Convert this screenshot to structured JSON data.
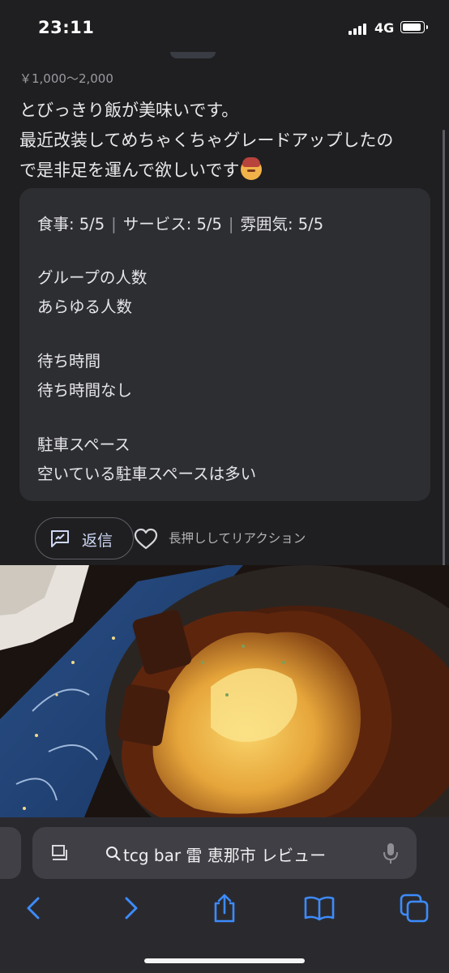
{
  "status_bar": {
    "time": "23:11",
    "network": "4G",
    "battery_level": 0.9
  },
  "review": {
    "price": "￥1,000～2,000",
    "text_lines": [
      "とびっきり飯が美味いです。",
      "最近改装してめちゃくちゃグレードアップしたの",
      "で是非足を運んで欲しいです"
    ],
    "emoji": "person-gesturing-ok-emoji",
    "ratings": {
      "food": "食事: 5/5",
      "service": "サービス: 5/5",
      "atmosphere": "雰囲気: 5/5",
      "separator": "|"
    },
    "details": [
      {
        "label": "グループの人数",
        "value": "あらゆる人数"
      },
      {
        "label": "待ち時間",
        "value": "待ち時間なし"
      },
      {
        "label": "駐車スペース",
        "value": "空いている駐車スペースは多い"
      }
    ],
    "reply_label": "返信",
    "reaction_hint": "長押ししてリアクション"
  },
  "browser": {
    "url_text": "tcg bar 雷 恵那市 レビュー",
    "toolbar": [
      "back-icon",
      "forward-icon",
      "share-icon",
      "bookmarks-icon",
      "tabs-icon"
    ],
    "accent": "#3d8bfd"
  }
}
